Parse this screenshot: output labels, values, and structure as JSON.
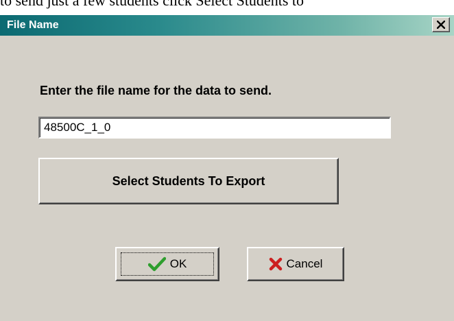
{
  "background_caption": "to send just a few students click Select Students to",
  "dialog": {
    "title": "File Name",
    "close_icon": "close-x-icon",
    "prompt": "Enter the file name for the data to send.",
    "filename_value": "48500C_1_0",
    "select_students_label": "Select Students To Export",
    "ok_label": "OK",
    "ok_icon": "green-checkmark-icon",
    "cancel_label": "Cancel",
    "cancel_icon": "red-x-icon"
  },
  "colors": {
    "titlebar_start": "#0b6a72",
    "titlebar_end": "#a8d5c6",
    "dialog_face": "#d4d0c8",
    "check_green": "#2e9e2e",
    "cancel_red": "#cc1f1f"
  }
}
